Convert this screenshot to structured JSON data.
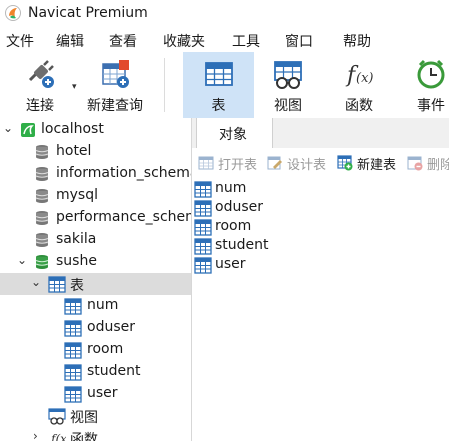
{
  "window": {
    "title": "Navicat Premium"
  },
  "menu": [
    "文件",
    "编辑",
    "查看",
    "收藏夹",
    "工具",
    "窗口",
    "帮助"
  ],
  "toolbar": {
    "connect": "连接",
    "new_query": "新建查询",
    "table": "表",
    "view": "视图",
    "function": "函数",
    "event": "事件"
  },
  "tree": {
    "connection": "localhost",
    "databases": [
      "hotel",
      "information_schema",
      "mysql",
      "performance_schema",
      "sakila",
      "sushe"
    ],
    "active_db": "sushe",
    "tables_node": "表",
    "tables": [
      "num",
      "oduser",
      "room",
      "student",
      "user"
    ],
    "views_node": "视图",
    "functions_node": "函数"
  },
  "content": {
    "tab": "对象",
    "actions": {
      "open": "打开表",
      "design": "设计表",
      "new": "新建表",
      "delete": "删除"
    },
    "objects": [
      "num",
      "oduser",
      "room",
      "student",
      "user"
    ]
  },
  "colors": {
    "active_tool_bg": "#cfe3f7",
    "selected_row_bg": "#dcdcdc",
    "table_icon": "#2d6fb7",
    "db_icon_green": "#3aa048"
  }
}
